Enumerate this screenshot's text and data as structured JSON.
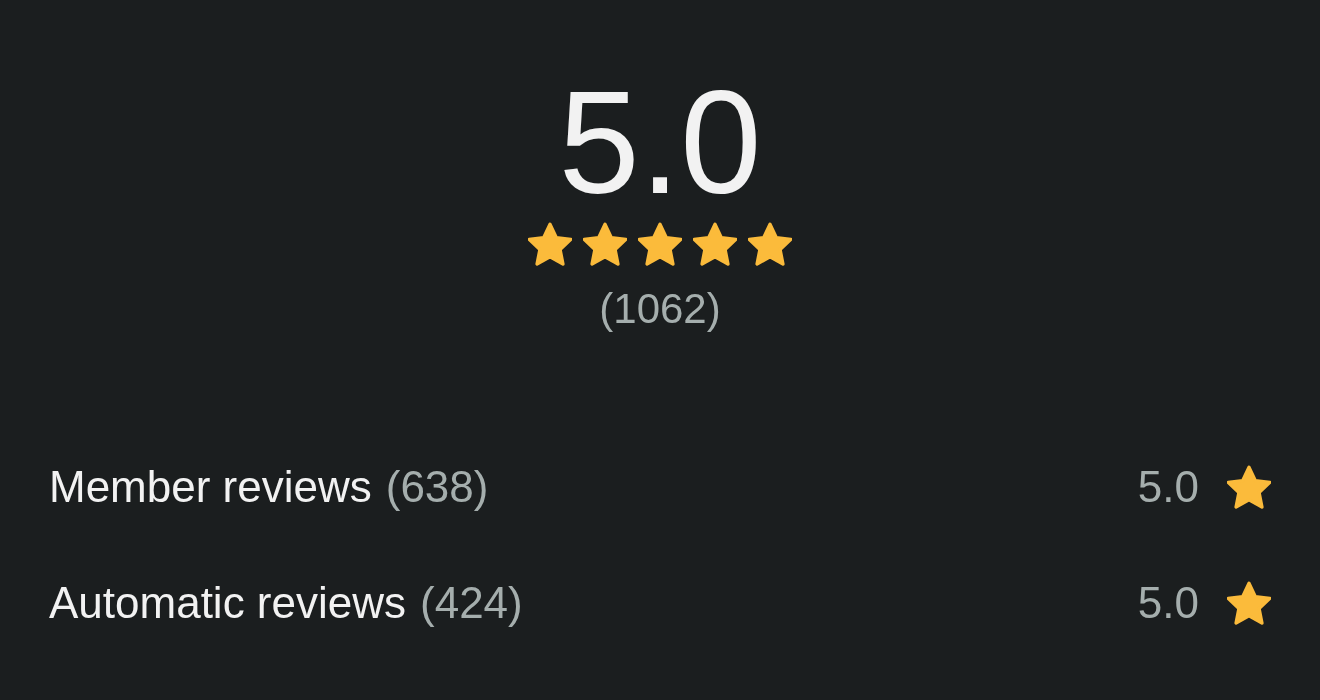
{
  "summary": {
    "rating": "5.0",
    "stars": 5,
    "count": "(1062)"
  },
  "breakdown": [
    {
      "label": "Member reviews",
      "count": "(638)",
      "score": "5.0"
    },
    {
      "label": "Automatic reviews",
      "count": "(424)",
      "score": "5.0"
    }
  ]
}
